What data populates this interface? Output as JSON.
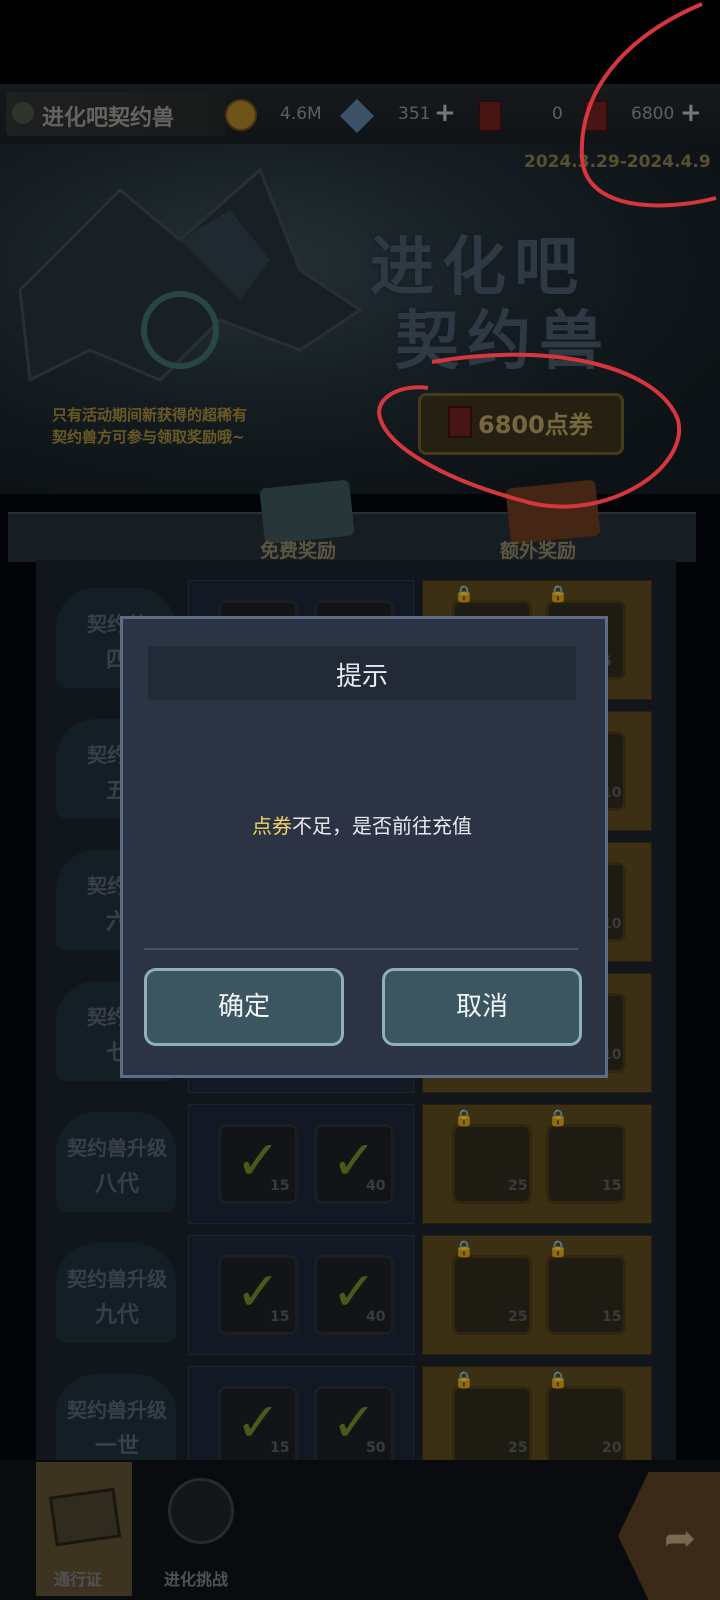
{
  "header": {
    "title": "进化吧契约兽",
    "resources": {
      "gold": "4.6M",
      "crystal": "351",
      "tickets": "0",
      "points": "6800"
    },
    "event_dates": "2024.3.29-2024.4.9"
  },
  "banner": {
    "line1": "进化吧",
    "line2": "契约兽",
    "note_line1": "只有活动期间新获得的超稀有",
    "note_line2": "契约兽方可参与领取奖励哦~",
    "price": "6800点券"
  },
  "tabs": {
    "free": "免费奖励",
    "extra": "额外奖励"
  },
  "rows": [
    {
      "label1": "契约兽",
      "label2": "四",
      "free": [],
      "extra": [
        "",
        "5"
      ]
    },
    {
      "label1": "契约兽",
      "label2": "五",
      "free": [],
      "extra": [
        "",
        "10"
      ]
    },
    {
      "label1": "契约兽",
      "label2": "六",
      "free": [],
      "extra": [
        "",
        "10"
      ]
    },
    {
      "label1": "契约兽",
      "label2": "七",
      "free": [],
      "extra": [
        "",
        "10"
      ]
    },
    {
      "label1": "契约兽升级",
      "label2": "八代",
      "free": [
        "15",
        "40"
      ],
      "extra": [
        "25",
        "15"
      ]
    },
    {
      "label1": "契约兽升级",
      "label2": "九代",
      "free": [
        "15",
        "40"
      ],
      "extra": [
        "25",
        "15"
      ]
    },
    {
      "label1": "契约兽升级",
      "label2": "一世",
      "free": [
        "15",
        "50"
      ],
      "extra": [
        "25",
        "20"
      ]
    }
  ],
  "nav": {
    "pass": "通行证",
    "challenge": "进化挑战"
  },
  "dialog": {
    "title": "提示",
    "msg_highlight": "点券",
    "msg_rest": "不足，是否前往充值",
    "confirm": "确定",
    "cancel": "取消"
  },
  "colors": {
    "highlight": "#f0d36a",
    "annotation": "#d6363e"
  }
}
